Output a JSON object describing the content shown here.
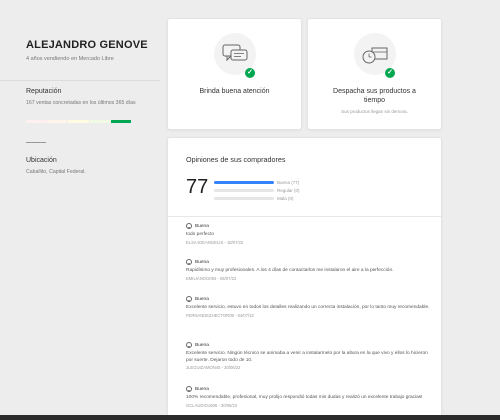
{
  "seller": {
    "name": "ALEJANDRO GENOVE",
    "subtitle": "4 años vendiendo en Mercado Libre"
  },
  "reputation": {
    "title": "Reputación",
    "text": "167 ventas concretadas en los últimos 365 días",
    "thermometer_colors": [
      "#fff0f0",
      "#fff5ea",
      "#fffce0",
      "#f1fbe3",
      "#00a650"
    ],
    "level": 5
  },
  "location": {
    "title": "Ubicación",
    "text": "Caballito, Capital Federal."
  },
  "cards": [
    {
      "label": "Brinda buena atención",
      "note": "",
      "icon": "chat-bubbles-icon",
      "check_icon": "check-icon"
    },
    {
      "label": "Despacha sus productos a tiempo",
      "note": "Sus productos llegan sin demora.",
      "icon": "box-clock-icon",
      "check_icon": "check-icon"
    }
  ],
  "opinions": {
    "title": "Opiniones de sus compradores",
    "score": "77",
    "bars": [
      {
        "label": "Buena (77)",
        "fraction": 1.0
      },
      {
        "label": "Regular (0)",
        "fraction": 0.0
      },
      {
        "label": "Mala (0)",
        "fraction": 0.0
      }
    ],
    "reviews": [
      {
        "rating": "Buena",
        "text": "todo perfecto",
        "meta": "ELSA-IDEANGELIS - 18/07/22"
      },
      {
        "rating": "Buena",
        "text": "Rapidísimo y muy profesionales. A los 4 días de contactarlos me instalaron el aire a la perfección.",
        "meta": "EMILIANOG094 - 05/07/22"
      },
      {
        "rating": "Buena",
        "text": "Excelente servicio, estuvo en todos los detalles realizando un correcta instalación, por lo tanto muy recomendable.",
        "meta": "FERNANDEZHECTOR09 - 04/07/22"
      },
      {
        "rating": "Buena",
        "text": "Excelente servicio. Ningún técnico se animaba a venir a instalarmelo por la altura en la que vivo y ellos lo hicieron por suerte. Dejaron todo de 10.",
        "meta": "JLEGUIZAMON45 - 30/06/22"
      },
      {
        "rating": "Buena",
        "text": "100% recomendable, profesional, muy prolijo respondió todas mis dudas y realizó un excelente trabajo gracias!",
        "meta": "GCLAUDIO1606 - 30/06/22"
      }
    ]
  }
}
